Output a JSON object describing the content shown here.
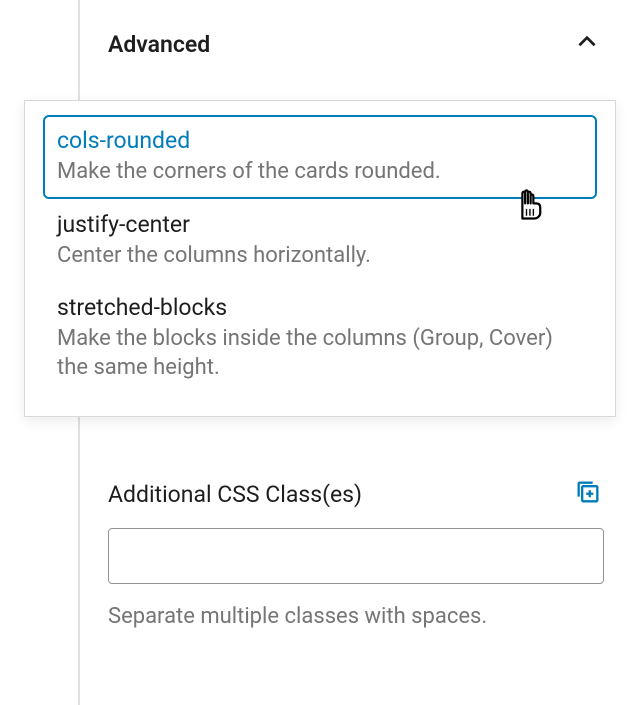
{
  "panel": {
    "title": "Advanced"
  },
  "dropdown": {
    "items": [
      {
        "name": "cols-rounded",
        "desc": "Make the corners of the cards rounded."
      },
      {
        "name": "justify-center",
        "desc": "Center the columns horizontally."
      },
      {
        "name": "stretched-blocks",
        "desc": "Make the blocks inside the columns (Group, Cover) the same height."
      }
    ]
  },
  "field": {
    "label": "Additional CSS Class(es)",
    "value": "",
    "help": "Separate multiple classes with spaces."
  }
}
